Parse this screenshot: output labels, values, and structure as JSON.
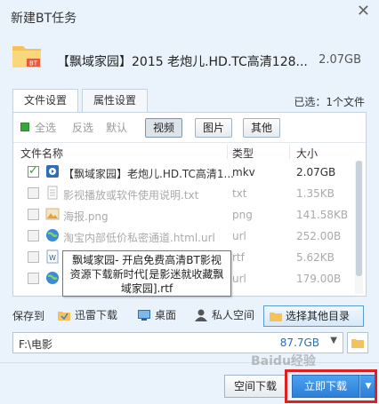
{
  "window": {
    "title": "新建BT任务",
    "close_glyph": "✕"
  },
  "file": {
    "name": "【飘域家园】2015 老炮儿.HD.TC高清128...",
    "size": "2.07GB",
    "folder_badge": "BT"
  },
  "tabs": [
    {
      "label": "文件设置",
      "active": true
    },
    {
      "label": "属性设置",
      "active": false
    }
  ],
  "selected_count": "已选：1个文件",
  "filters": {
    "all": "全选",
    "invert": "反选",
    "default": "默认",
    "video": "视频",
    "image": "图片",
    "other": "其他"
  },
  "columns": {
    "name": "文件名称",
    "type": "类型",
    "size": "大小"
  },
  "rows": [
    {
      "name": "【飘域家园】老炮儿.HD.TC高清1...",
      "type": "mkv",
      "size": "2.07GB",
      "checked": true,
      "icon": "video-file-icon"
    },
    {
      "name": "影视播放或软件使用说明.txt",
      "type": "txt",
      "size": "1.35KB",
      "checked": false,
      "icon": "text-file-icon"
    },
    {
      "name": "海报.png",
      "type": "png",
      "size": "141.58KB",
      "checked": false,
      "icon": "image-file-icon"
    },
    {
      "name": "淘宝内部低价私密通道.html.url",
      "type": "url",
      "size": "252.00B",
      "checked": false,
      "icon": "url-file-icon"
    },
    {
      "name": "",
      "type": "rtf",
      "size": "5.62KB",
      "checked": false,
      "icon": "rtf-file-icon"
    },
    {
      "name": "",
      "type": "url",
      "size": "179.00B",
      "checked": false,
      "icon": "url-file-icon"
    }
  ],
  "tooltip": "飘域家园- 开启免费高清BT影视资源下载新时代[是影迷就收藏飘域家园].rtf",
  "save": {
    "label": "保存到",
    "options": [
      "迅雷下载",
      "桌面",
      "私人空间"
    ],
    "other_button": "选择其他目录",
    "path": "F:\\电影",
    "free_space": "87.7GB"
  },
  "buttons": {
    "space_download": "空间下载",
    "download_now": "立即下载"
  },
  "watermark": "Baidu经验",
  "colors": {
    "accent": "#2d7fd6",
    "highlight": "#e02020"
  }
}
